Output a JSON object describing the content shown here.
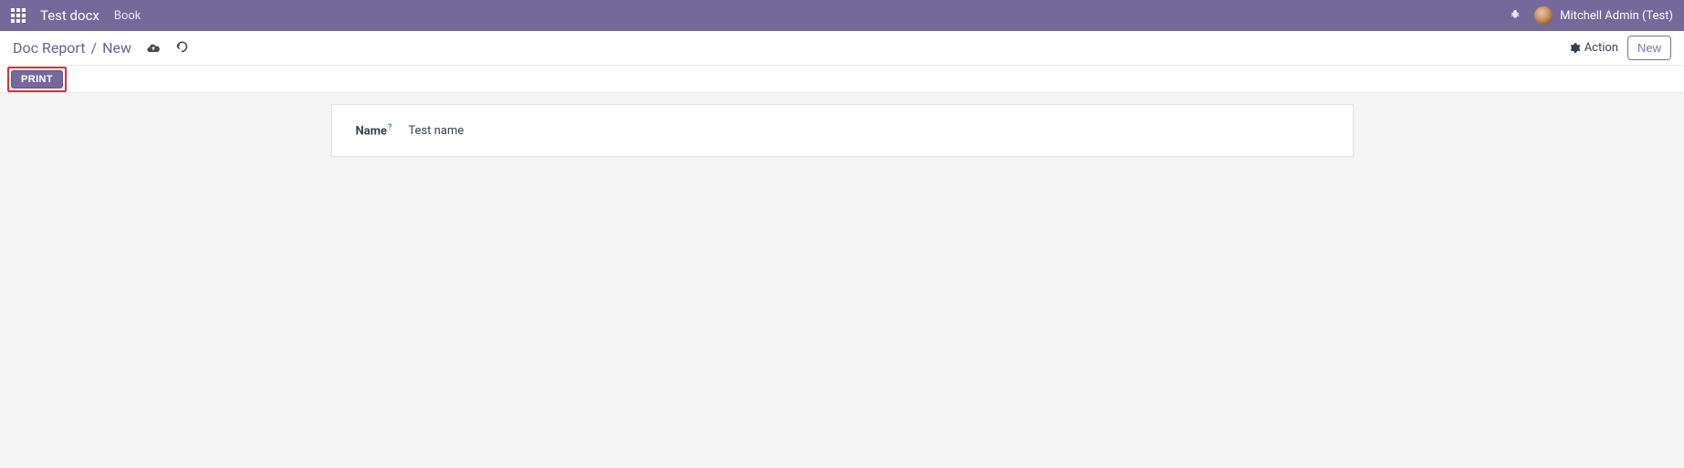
{
  "navbar": {
    "app_title": "Test docx",
    "menu_items": [
      "Book"
    ],
    "user_name": "Mitchell Admin (Test)"
  },
  "control_panel": {
    "breadcrumb_root": "Doc Report",
    "breadcrumb_separator": "/",
    "breadcrumb_current": "New",
    "action_label": "Action",
    "new_button_label": "New"
  },
  "status_bar": {
    "print_label": "PRINT"
  },
  "form": {
    "name_field_label": "Name",
    "name_field_help_marker": "?",
    "name_field_value": "Test name"
  }
}
